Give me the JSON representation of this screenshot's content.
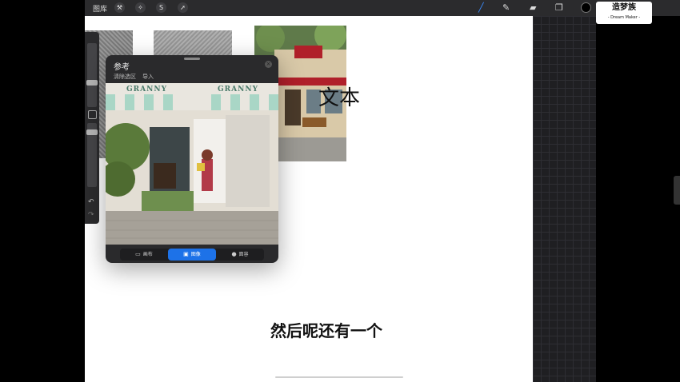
{
  "topbar": {
    "gallery_label": "图库",
    "tools_left": [
      {
        "icon": "wrench-icon",
        "glyph": "⚒"
      },
      {
        "icon": "magic-wand-icon",
        "glyph": "✧"
      },
      {
        "icon": "selection-icon",
        "glyph": "S"
      },
      {
        "icon": "transform-arrow-icon",
        "glyph": "➚"
      }
    ],
    "tools_right": [
      {
        "icon": "brush-icon",
        "glyph": "╱",
        "active": true
      },
      {
        "icon": "smudge-icon",
        "glyph": "✎"
      },
      {
        "icon": "eraser-icon",
        "glyph": "▰"
      },
      {
        "icon": "layers-icon",
        "glyph": "❐"
      }
    ],
    "current_color": "#000000"
  },
  "logo": {
    "title": "造梦族",
    "subtitle": "- Dream Maker -"
  },
  "canvas": {
    "text_layer": "文本",
    "subtitle": "然后呢还有一个"
  },
  "reference_panel": {
    "title": "参考",
    "clear_selection": "清除选区",
    "import": "导入",
    "image_sign_left": "GRANNY",
    "image_sign_right": "GRANNY",
    "tabs": [
      {
        "label": "画布",
        "icon": "canvas-icon",
        "active": false
      },
      {
        "label": "图像",
        "icon": "image-icon",
        "active": true
      },
      {
        "label": "面容",
        "icon": "face-icon",
        "active": false
      }
    ]
  },
  "colors": {
    "accent": "#1d72e8",
    "toolbar_bg": "#2b2b2d"
  }
}
